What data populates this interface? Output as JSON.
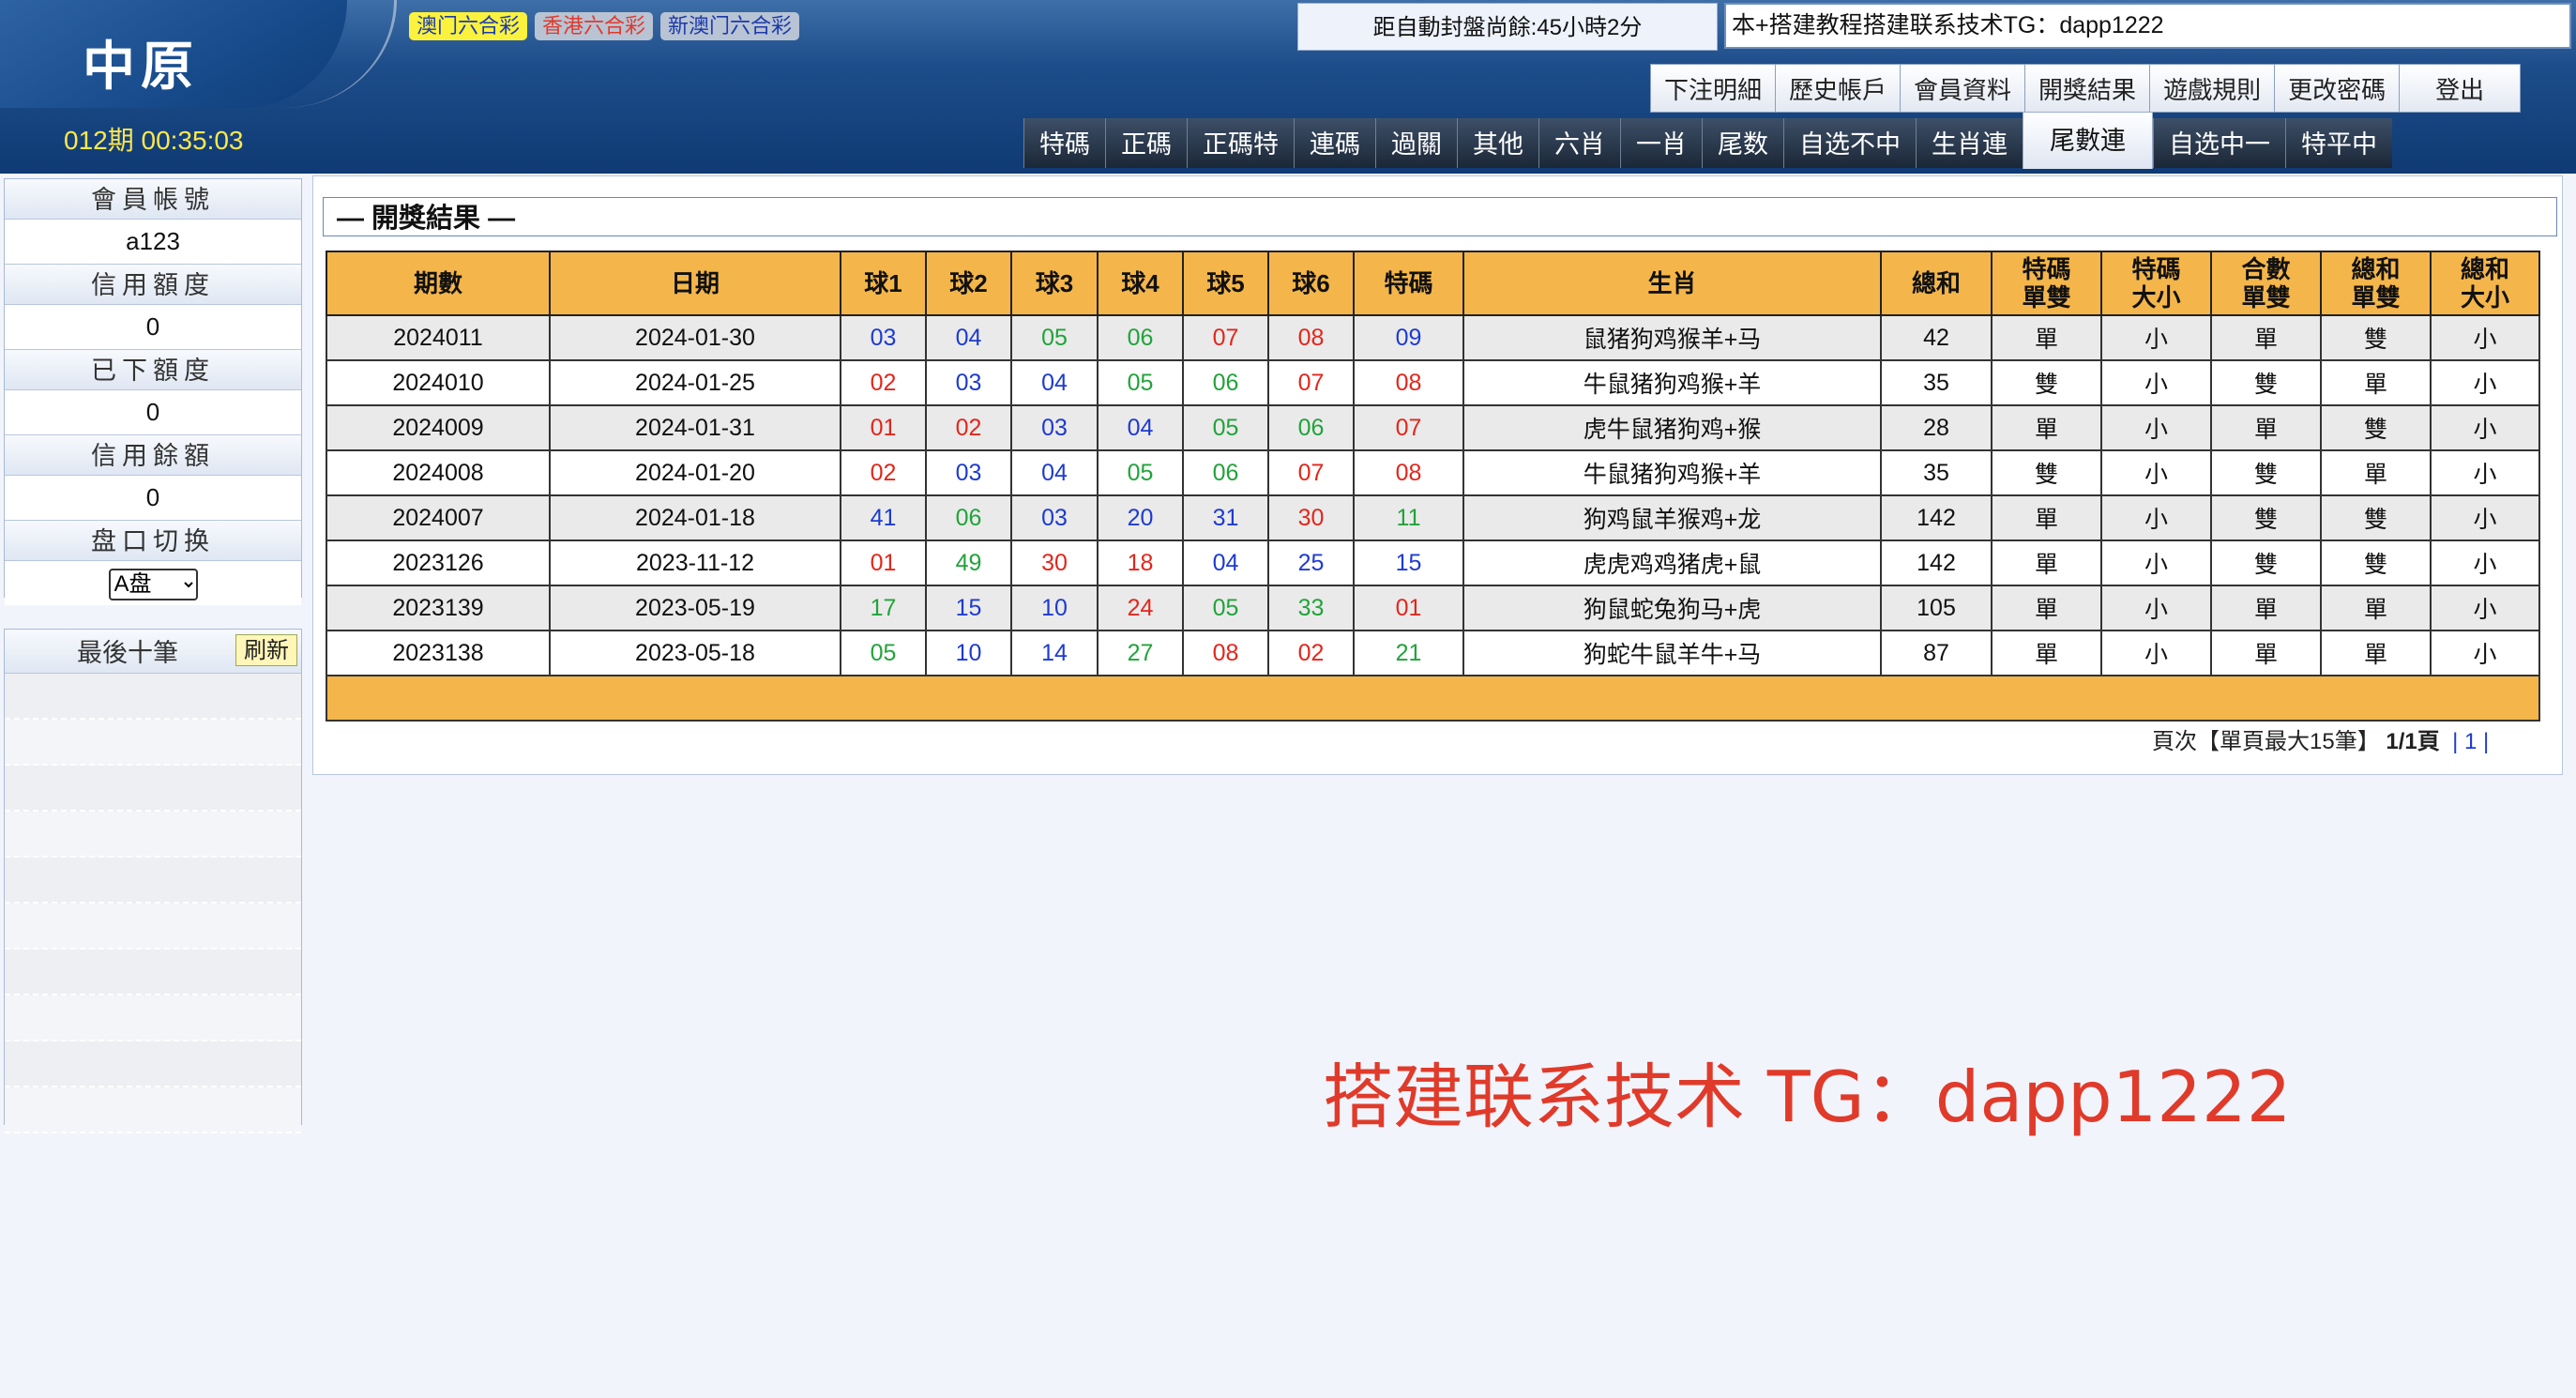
{
  "header": {
    "logo": "中原",
    "lottery_tabs": [
      "澳门六合彩",
      "香港六合彩",
      "新澳门六合彩"
    ],
    "countdown": "距自動封盤尚餘:45小時2分",
    "notice": "本+搭建教程搭建联系技术TG：dapp1222",
    "top_menu": [
      "下注明細",
      "歷史帳戶",
      "會員資料",
      "開獎結果",
      "遊戲規則",
      "更改密碼",
      "登出"
    ],
    "period": "012期 00:35:03",
    "nav_tabs": [
      "特碼",
      "正碼",
      "正碼特",
      "連碼",
      "過關",
      "其他",
      "六肖",
      "一肖",
      "尾数",
      "自选不中",
      "生肖連",
      "尾數連",
      "自选中一",
      "特平中"
    ],
    "active_nav": "尾數連"
  },
  "sidebar": {
    "account_label": "會員帳號",
    "account_value": "a123",
    "credit_label": "信用額度",
    "credit_value": "0",
    "placed_label": "已下額度",
    "placed_value": "0",
    "balance_label": "信用餘額",
    "balance_value": "0",
    "plate_label": "盘口切换",
    "plate_value": "A盘",
    "recent_label": "最後十筆",
    "refresh_label": "刷新"
  },
  "results": {
    "title": "— 開獎結果 —",
    "headers": [
      "期數",
      "日期",
      "球1",
      "球2",
      "球3",
      "球4",
      "球5",
      "球6",
      "特碼",
      "生肖",
      "總和",
      "特碼 單雙",
      "特碼 大小",
      "合數 單雙",
      "總和 單雙",
      "總和 大小"
    ],
    "rows": [
      {
        "issue": "2024011",
        "date": "2024-01-30",
        "balls": [
          "03",
          "04",
          "05",
          "06",
          "07",
          "08"
        ],
        "colors": [
          "blue",
          "blue",
          "green",
          "green",
          "red",
          "red"
        ],
        "special": "09",
        "special_color": "blue",
        "zodiac": "鼠猪狗鸡猴羊+马",
        "sum": "42",
        "sp_oe": "單",
        "sp_bs": "小",
        "hs_oe": "單",
        "sum_oe": "雙",
        "sum_bs": "小"
      },
      {
        "issue": "2024010",
        "date": "2024-01-25",
        "balls": [
          "02",
          "03",
          "04",
          "05",
          "06",
          "07"
        ],
        "colors": [
          "red",
          "blue",
          "blue",
          "green",
          "green",
          "red"
        ],
        "special": "08",
        "special_color": "red",
        "zodiac": "牛鼠猪狗鸡猴+羊",
        "sum": "35",
        "sp_oe": "雙",
        "sp_bs": "小",
        "hs_oe": "雙",
        "sum_oe": "單",
        "sum_bs": "小"
      },
      {
        "issue": "2024009",
        "date": "2024-01-31",
        "balls": [
          "01",
          "02",
          "03",
          "04",
          "05",
          "06"
        ],
        "colors": [
          "red",
          "red",
          "blue",
          "blue",
          "green",
          "green"
        ],
        "special": "07",
        "special_color": "red",
        "zodiac": "虎牛鼠猪狗鸡+猴",
        "sum": "28",
        "sp_oe": "單",
        "sp_bs": "小",
        "hs_oe": "單",
        "sum_oe": "雙",
        "sum_bs": "小"
      },
      {
        "issue": "2024008",
        "date": "2024-01-20",
        "balls": [
          "02",
          "03",
          "04",
          "05",
          "06",
          "07"
        ],
        "colors": [
          "red",
          "blue",
          "blue",
          "green",
          "green",
          "red"
        ],
        "special": "08",
        "special_color": "red",
        "zodiac": "牛鼠猪狗鸡猴+羊",
        "sum": "35",
        "sp_oe": "雙",
        "sp_bs": "小",
        "hs_oe": "雙",
        "sum_oe": "單",
        "sum_bs": "小"
      },
      {
        "issue": "2024007",
        "date": "2024-01-18",
        "balls": [
          "41",
          "06",
          "03",
          "20",
          "31",
          "30"
        ],
        "colors": [
          "blue",
          "green",
          "blue",
          "blue",
          "blue",
          "red"
        ],
        "special": "11",
        "special_color": "green",
        "zodiac": "狗鸡鼠羊猴鸡+龙",
        "sum": "142",
        "sp_oe": "單",
        "sp_bs": "小",
        "hs_oe": "雙",
        "sum_oe": "雙",
        "sum_bs": "小"
      },
      {
        "issue": "2023126",
        "date": "2023-11-12",
        "balls": [
          "01",
          "49",
          "30",
          "18",
          "04",
          "25"
        ],
        "colors": [
          "red",
          "green",
          "red",
          "red",
          "blue",
          "blue"
        ],
        "special": "15",
        "special_color": "blue",
        "zodiac": "虎虎鸡鸡猪虎+鼠",
        "sum": "142",
        "sp_oe": "單",
        "sp_bs": "小",
        "hs_oe": "雙",
        "sum_oe": "雙",
        "sum_bs": "小"
      },
      {
        "issue": "2023139",
        "date": "2023-05-19",
        "balls": [
          "17",
          "15",
          "10",
          "24",
          "05",
          "33"
        ],
        "colors": [
          "green",
          "blue",
          "blue",
          "red",
          "green",
          "green"
        ],
        "special": "01",
        "special_color": "red",
        "zodiac": "狗鼠蛇兔狗马+虎",
        "sum": "105",
        "sp_oe": "單",
        "sp_bs": "小",
        "hs_oe": "單",
        "sum_oe": "單",
        "sum_bs": "小"
      },
      {
        "issue": "2023138",
        "date": "2023-05-18",
        "balls": [
          "05",
          "10",
          "14",
          "27",
          "08",
          "02"
        ],
        "colors": [
          "green",
          "blue",
          "blue",
          "green",
          "red",
          "red"
        ],
        "special": "21",
        "special_color": "green",
        "zodiac": "狗蛇牛鼠羊牛+马",
        "sum": "87",
        "sp_oe": "單",
        "sp_bs": "小",
        "hs_oe": "單",
        "sum_oe": "單",
        "sum_bs": "小"
      }
    ],
    "pager_prefix": "頁次【單頁最大15筆】",
    "pager_pages": "1/1頁",
    "pager_link": "| 1 |"
  },
  "watermark": "搭建联系技术 TG：dapp1222",
  "colors": {
    "red": "#e3261c",
    "blue": "#1d3bd1",
    "green": "#21a33a",
    "header_bg": "#f4b64a",
    "nav_dark": "#1b2737",
    "period": "#ffe84b"
  }
}
